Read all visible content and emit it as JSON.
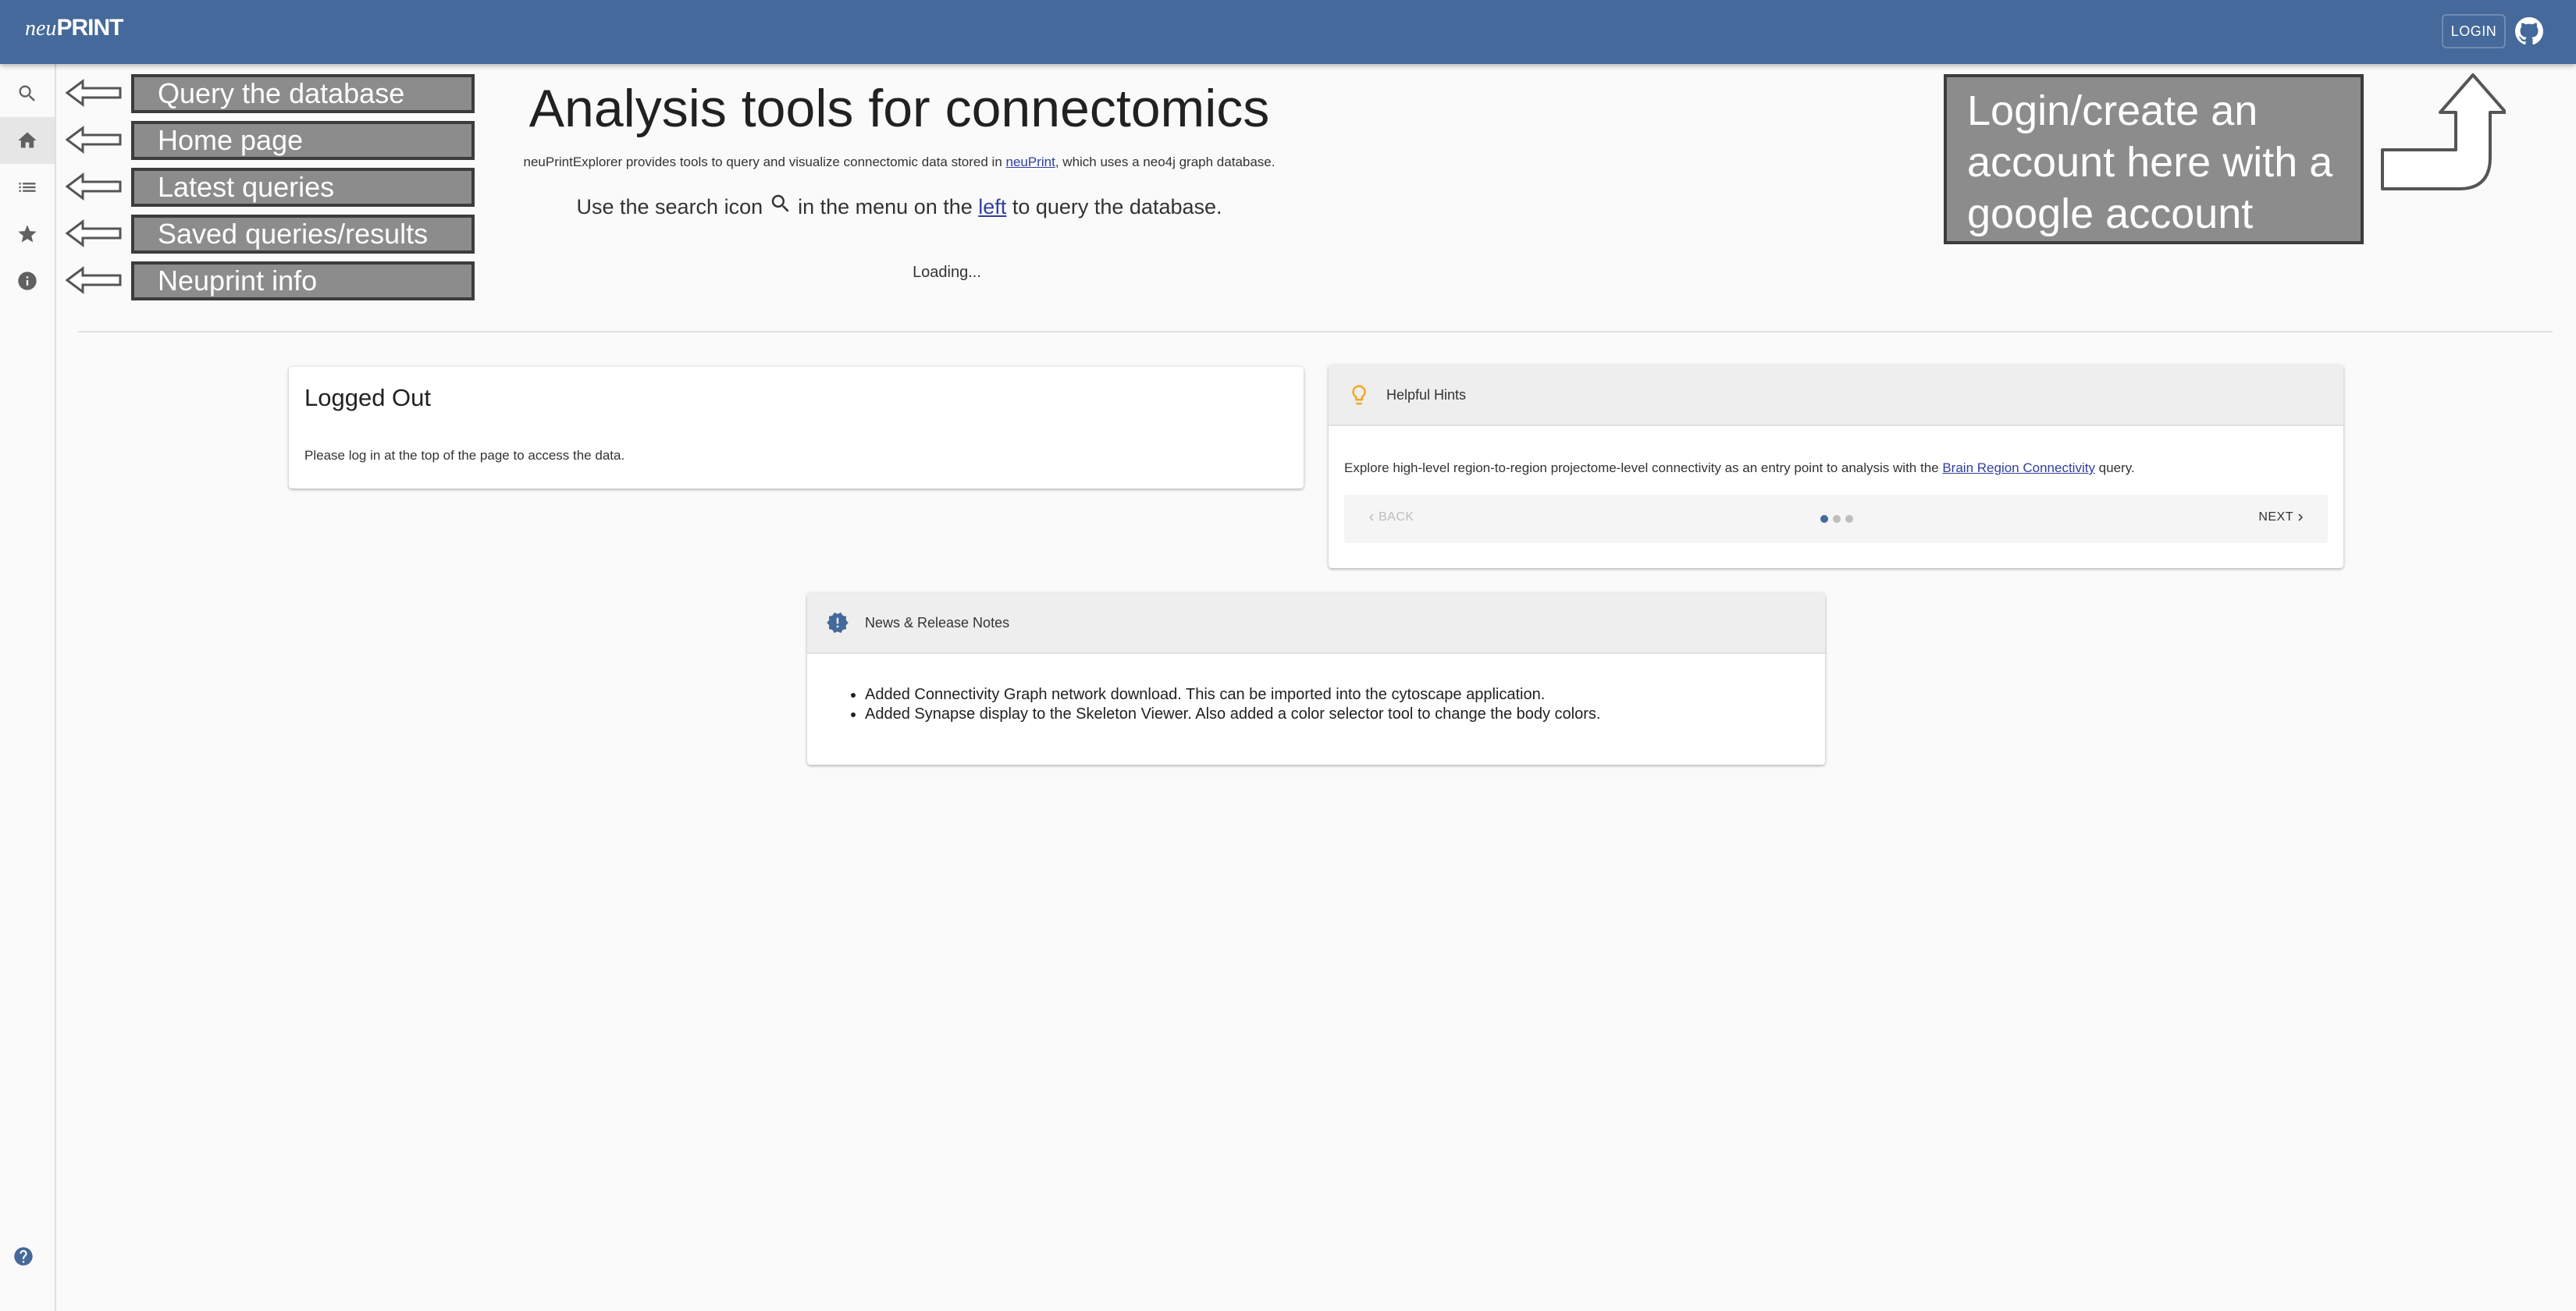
{
  "app": {
    "logo_prefix": "neu",
    "logo_main": "PRINT",
    "login_label": "LOGIN",
    "brand_color": "#44699a"
  },
  "sidebar": {
    "items": [
      {
        "icon": "search-icon"
      },
      {
        "icon": "home-icon",
        "active": true
      },
      {
        "icon": "list-icon"
      },
      {
        "icon": "star-icon"
      },
      {
        "icon": "info-icon"
      }
    ],
    "footer_icon": "help-icon"
  },
  "callouts": {
    "query": "Query the database",
    "home": "Home page",
    "latest": "Latest queries",
    "saved": "Saved queries/results",
    "info": "Neuprint info",
    "login": "Login/create an account here with a google account"
  },
  "hero": {
    "title": "Analysis tools for connectomics",
    "desc_before": "neuPrintExplorer provides tools to query and visualize connectomic data stored in ",
    "desc_link": "neuPrint",
    "desc_after": ", which uses a neo4j graph database.",
    "hint_before": "Use the search icon ",
    "hint_middle": " in the menu on the ",
    "hint_link": "left",
    "hint_after": " to query the database.",
    "loading": "Loading..."
  },
  "logged_out": {
    "title": "Logged Out",
    "message": "Please log in at the top of the page to access the data."
  },
  "hints": {
    "title": "Helpful Hints",
    "text_before": "Explore high-level region-to-region projectome-level connectivity as an entry point to analysis with the ",
    "text_link": "Brain Region Connectivity",
    "text_after": " query.",
    "back_label": "BACK",
    "next_label": "NEXT",
    "step_count": 3,
    "active_step": 1
  },
  "news": {
    "title": "News & Release Notes",
    "items": [
      "Added Connectivity Graph network download. This can be imported into the cytoscape application.",
      "Added Synapse display to the Skeleton Viewer. Also added a color selector tool to change the body colors."
    ]
  }
}
